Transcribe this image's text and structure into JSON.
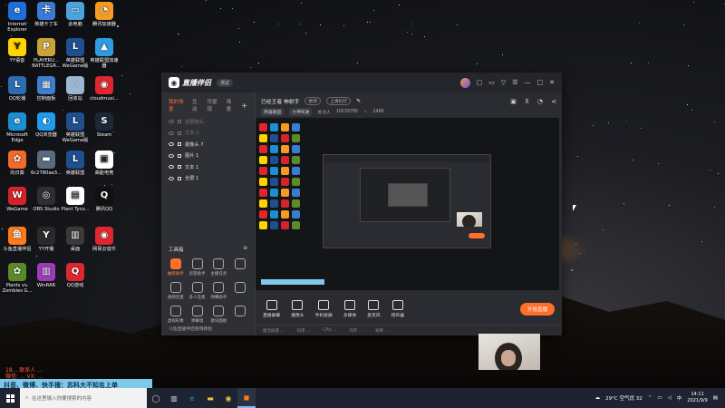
{
  "desktop": {
    "icons": [
      {
        "label": "Internet Explorer",
        "color": "#1e6fd9",
        "glyph": "e"
      },
      {
        "label": "英雄卡丁车",
        "color": "#3a7bd5",
        "glyph": "卡"
      },
      {
        "label": "此电脑",
        "color": "#4aa3df",
        "glyph": "▭"
      },
      {
        "label": "腾讯加速器",
        "color": "#f59a23",
        "glyph": "◔"
      },
      {
        "label": "YY语音",
        "color": "#ffd400",
        "glyph": "Y"
      },
      {
        "label": "PLAYERU... BATTLEGR...",
        "color": "#c9a33a",
        "glyph": "P"
      },
      {
        "label": "英雄联盟 WeGame版",
        "color": "#1f4f8f",
        "glyph": "L"
      },
      {
        "label": "英雄联盟加速器",
        "color": "#2f9be0",
        "glyph": "▲"
      },
      {
        "label": "QQ轮播",
        "color": "#2b6cb3",
        "glyph": "L"
      },
      {
        "label": "控制面板",
        "color": "#3d7fd1",
        "glyph": "▦"
      },
      {
        "label": "回收站",
        "color": "#9bb8d3",
        "glyph": "♲"
      },
      {
        "label": "cloudmusi...",
        "color": "#e0262e",
        "glyph": "◉"
      },
      {
        "label": "Microsoft Edge",
        "color": "#1b8fd4",
        "glyph": "e"
      },
      {
        "label": "QQ浏览器",
        "color": "#1f9cf0",
        "glyph": "◐"
      },
      {
        "label": "英雄联盟 WeGame版",
        "color": "#1f4f8f",
        "glyph": "L"
      },
      {
        "label": "Steam",
        "color": "#1b2838",
        "glyph": "S"
      },
      {
        "label": "向日葵",
        "color": "#f06b2b",
        "glyph": "✿"
      },
      {
        "label": "6c2780ae3...",
        "color": "#5a6b7d",
        "glyph": "▬"
      },
      {
        "label": "英雄联盟",
        "color": "#1f4f8f",
        "glyph": "L"
      },
      {
        "label": "高能电竞",
        "color": "#ffffff",
        "glyph": "▣"
      },
      {
        "label": "WeGame",
        "color": "#d6222a",
        "glyph": "W"
      },
      {
        "label": "OBS Studio",
        "color": "#302e31",
        "glyph": "◎"
      },
      {
        "label": "Plant Tyco...",
        "color": "#ffffff",
        "glyph": "▤"
      },
      {
        "label": "腾讯QQ",
        "color": "#111111",
        "glyph": "Q"
      },
      {
        "label": "斗鱼直播伴侣",
        "color": "#ff7a1a",
        "glyph": "鱼"
      },
      {
        "label": "YY开播",
        "color": "#2a2a2a",
        "glyph": "Y"
      },
      {
        "label": "桌面",
        "color": "#3a3a3a",
        "glyph": "▥"
      },
      {
        "label": "网易云音乐",
        "color": "#e0262e",
        "glyph": "◉"
      },
      {
        "label": "Plants vs. Zombies G...",
        "color": "#5a8a2a",
        "glyph": "✿"
      },
      {
        "label": "WinRAR",
        "color": "#9b3bb5",
        "glyph": "▥"
      },
      {
        "label": "QQ游戏",
        "color": "#e0262e",
        "glyph": "Q"
      }
    ]
  },
  "overlay": {
    "line1": "18... 联系人 ...",
    "line2": "微信: ... VX: ...",
    "ticker": "抖音、微博、快手搜：苏科大不知名上单"
  },
  "app": {
    "name": "直播伴侣",
    "beta": "测试",
    "tabs": [
      "我的场景",
      "互动",
      "可提现",
      "场景"
    ],
    "sources": [
      {
        "name": "竖屏镜头",
        "dim": true
      },
      {
        "name": "文本 2",
        "dim": true
      },
      {
        "name": "摄像头 7",
        "dim": false
      },
      {
        "name": "图片 1",
        "dim": false
      },
      {
        "name": "文本 1",
        "dim": false
      },
      {
        "name": "全屏 1",
        "dim": false
      }
    ],
    "toolbox_title": "工具箱",
    "tools": [
      {
        "label": "抽奖助手",
        "hot": true
      },
      {
        "label": "房管助手",
        "hot": false
      },
      {
        "label": "主播任务",
        "hot": false
      },
      {
        "label": "",
        "hot": false
      },
      {
        "label": "视频连麦",
        "hot": false
      },
      {
        "label": "多人连麦",
        "hot": false
      },
      {
        "label": "弹幕助手",
        "hot": false
      },
      {
        "label": "",
        "hot": false
      },
      {
        "label": "虚拟形象",
        "hot": false
      },
      {
        "label": "弹幕墙",
        "hot": false
      },
      {
        "label": "歌词面板",
        "hot": false
      },
      {
        "label": "",
        "hot": false
      }
    ],
    "sidebar_footer": "斗鱼直播伴侣使用教程",
    "room": {
      "title": "已经王者 神射手",
      "tag": "修改",
      "upload": "上滑幻灯",
      "category": "英雄联盟",
      "chip2": "大神驾驶",
      "fans_label": "关注人",
      "fans": "10039785",
      "hot": "2486"
    },
    "bottom_buttons": [
      "直播屏幕",
      "摄像头",
      "手机投屏",
      "多媒体",
      "麦克风",
      "扬声器"
    ],
    "start_button": "开始直播",
    "status": [
      "推流质量 ...",
      "码率 ...",
      "CPU ...",
      "内存 ...",
      "帧率 ..."
    ]
  },
  "taskbar": {
    "search_placeholder": "在这里输入你要搜索的内容",
    "weather": "29°C 空气优 32",
    "time": "14:11",
    "date": "2021/9/9"
  }
}
